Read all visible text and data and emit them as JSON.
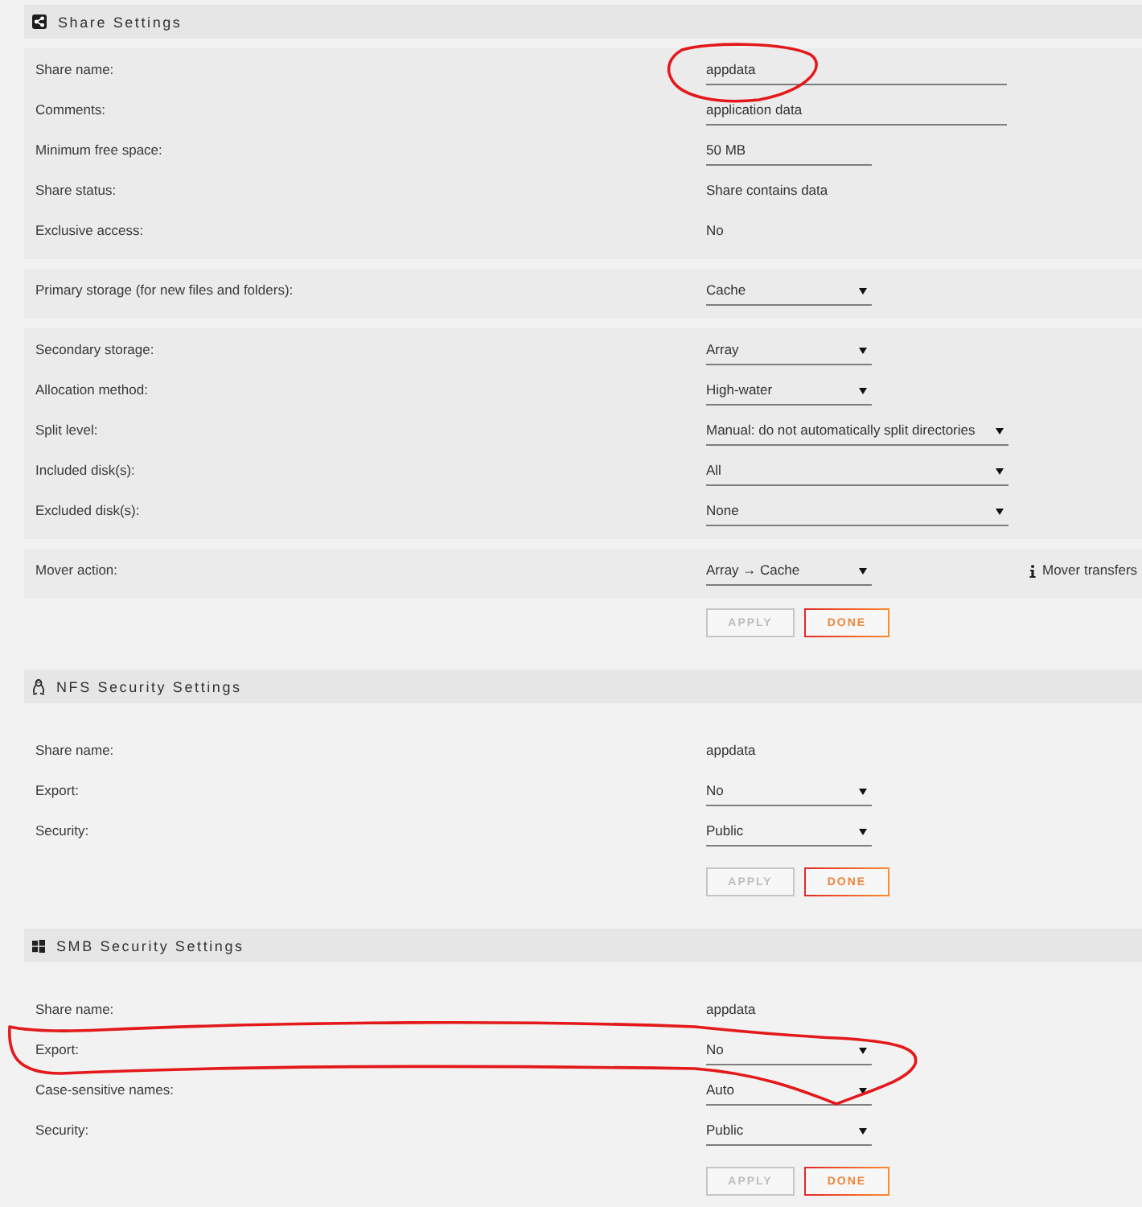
{
  "sections": [
    {
      "title": "Share Settings",
      "groups": [
        {
          "rows": [
            {
              "label": "Share name:",
              "kind": "input",
              "value": "appdata"
            },
            {
              "label": "Comments:",
              "kind": "input",
              "value": "application data"
            },
            {
              "label": "Minimum free space:",
              "kind": "shortinput",
              "value": "50 MB"
            },
            {
              "label": "Share status:",
              "kind": "text",
              "value": "Share contains data"
            },
            {
              "label": "Exclusive access:",
              "kind": "text",
              "value": "No"
            }
          ]
        },
        {
          "rows": [
            {
              "label": "Primary storage (for new files and folders):",
              "kind": "select",
              "value": "Cache"
            }
          ]
        },
        {
          "rows": [
            {
              "label": "Secondary storage:",
              "kind": "select",
              "value": "Array"
            },
            {
              "label": "Allocation method:",
              "kind": "select",
              "value": "High-water"
            },
            {
              "label": "Split level:",
              "kind": "wideselect",
              "value": "Manual: do not automatically split directories"
            },
            {
              "label": "Included disk(s):",
              "kind": "wideselect",
              "value": "All"
            },
            {
              "label": "Excluded disk(s):",
              "kind": "wideselect",
              "value": "None"
            }
          ]
        },
        {
          "rows": [
            {
              "label": "Mover action:",
              "kind": "select",
              "value": "Array → Cache",
              "note": "Mover transfers"
            }
          ]
        }
      ],
      "buttons": [
        {
          "label": "APPLY",
          "disabled": true
        },
        {
          "label": "DONE",
          "disabled": false
        }
      ]
    },
    {
      "title": "NFS Security Settings",
      "rows": [
        {
          "label": "Share name:",
          "kind": "text",
          "value": "appdata"
        },
        {
          "label": "Export:",
          "kind": "select",
          "value": "No"
        },
        {
          "label": "Security:",
          "kind": "select",
          "value": "Public"
        }
      ],
      "buttons": [
        {
          "label": "APPLY",
          "disabled": true
        },
        {
          "label": "DONE",
          "disabled": false
        }
      ]
    },
    {
      "title": "SMB Security Settings",
      "rows": [
        {
          "label": "Share name:",
          "kind": "text",
          "value": "appdata"
        },
        {
          "label": "Export:",
          "kind": "select",
          "value": "No"
        },
        {
          "label": "Case-sensitive names:",
          "kind": "select",
          "value": "Auto"
        },
        {
          "label": "Security:",
          "kind": "select",
          "value": "Public"
        }
      ],
      "buttons": [
        {
          "label": "APPLY",
          "disabled": true
        },
        {
          "label": "DONE",
          "disabled": false
        }
      ]
    }
  ]
}
